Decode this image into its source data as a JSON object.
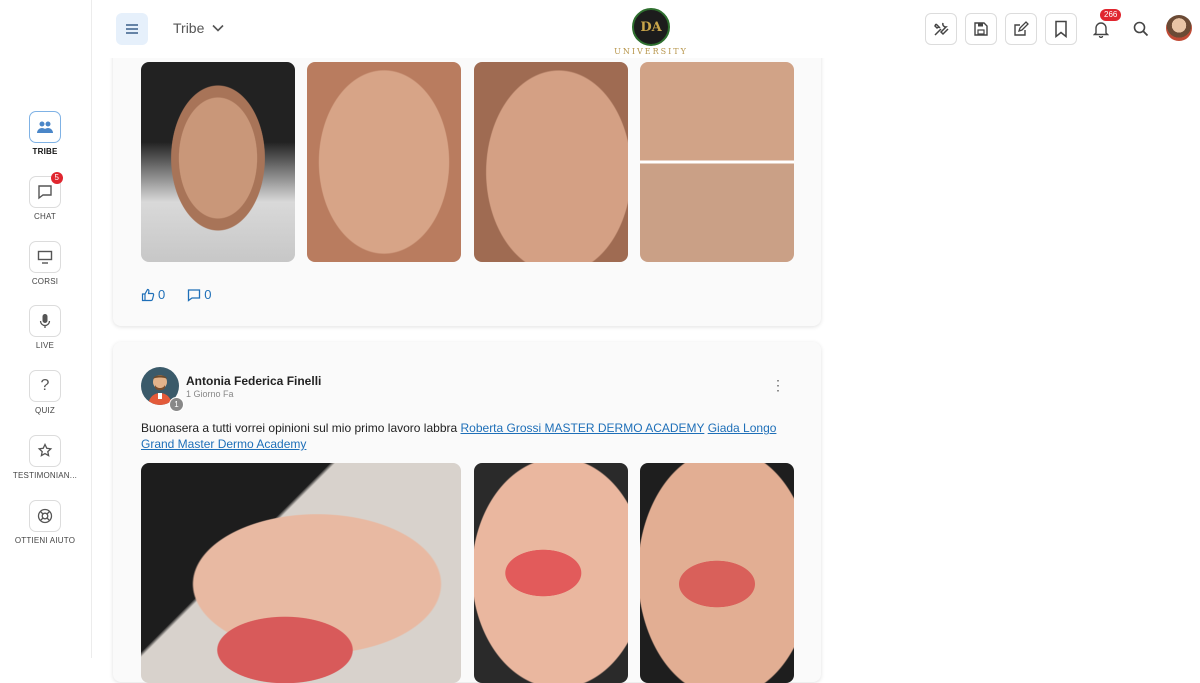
{
  "sidebar": {
    "items": [
      {
        "label": "TRIBE",
        "icon": "people-icon",
        "active": true
      },
      {
        "label": "CHAT",
        "icon": "chat-icon",
        "badge": "5"
      },
      {
        "label": "CORSI",
        "icon": "monitor-icon"
      },
      {
        "label": "LIVE",
        "icon": "microphone-icon"
      },
      {
        "label": "QUIZ",
        "icon": "question-icon"
      },
      {
        "label": "TESTIMONIAN...",
        "icon": "star-hand-icon"
      },
      {
        "label": "OTTIENI AIUTO",
        "icon": "lifebuoy-icon"
      }
    ]
  },
  "header": {
    "community_selector": "Tribe",
    "logo_initials": "DA",
    "logo_text": "UNIVERSITY",
    "notifications_badge": "266",
    "icons": [
      "tools-icon",
      "save-icon",
      "edit-icon",
      "bookmark-icon",
      "bell-icon",
      "search-icon",
      "avatar"
    ]
  },
  "posts": [
    {
      "likes": "0",
      "comments": "0"
    },
    {
      "author": "Antonia Federica Finelli",
      "author_level": "1",
      "time": "1 Giorno Fa",
      "text_prefix": "Buonasera a tutti vorrei opinioni sul mio primo lavoro labbra ",
      "mentions": [
        "Roberta Grossi MASTER DERMO ACADEMY",
        "Giada Longo",
        "Grand Master Dermo Academy"
      ]
    }
  ],
  "colors": {
    "accent": "#1e6fb8",
    "badge": "#e0262f",
    "menu_button_bg": "#e6f0fb"
  }
}
